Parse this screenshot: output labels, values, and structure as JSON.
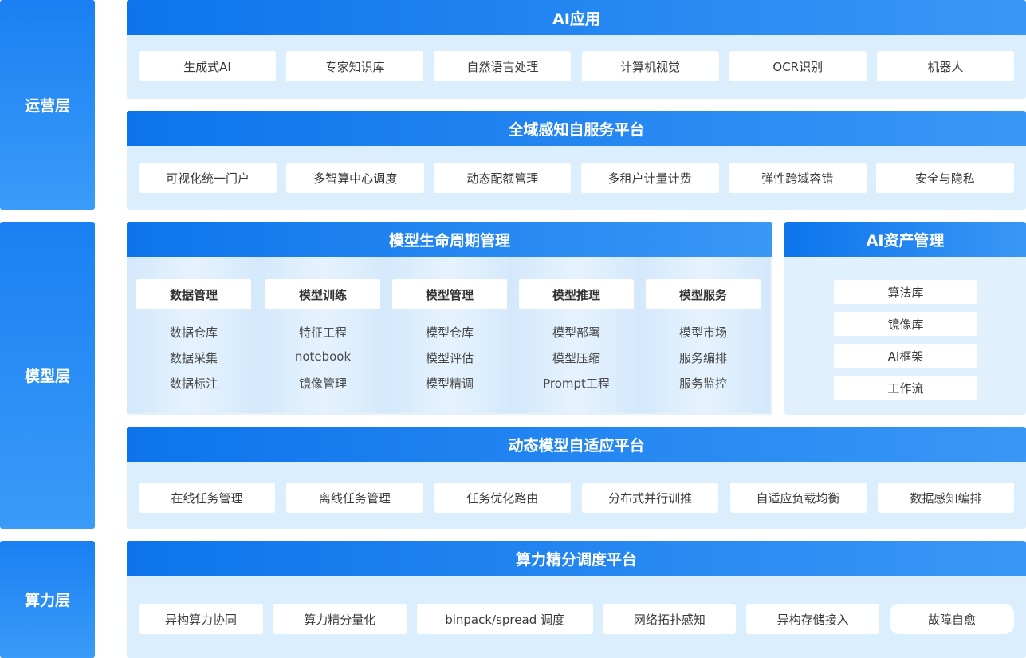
{
  "layers": {
    "ops": "运营层",
    "model": "模型层",
    "compute": "算力层"
  },
  "ai_app": {
    "title": "AI应用",
    "items": [
      "生成式AI",
      "专家知识库",
      "自然语言处理",
      "计算机视觉",
      "OCR识别",
      "机器人"
    ]
  },
  "self_service": {
    "title": "全域感知自服务平台",
    "items": [
      "可视化统一门户",
      "多智算中心调度",
      "动态配额管理",
      "多租户计量计费",
      "弹性跨域容错",
      "安全与隐私"
    ]
  },
  "lifecycle": {
    "title": "模型生命周期管理",
    "columns": [
      {
        "title": "数据管理",
        "items": [
          "数据仓库",
          "数据采集",
          "数据标注"
        ]
      },
      {
        "title": "模型训练",
        "items": [
          "特征工程",
          "notebook",
          "镜像管理"
        ]
      },
      {
        "title": "模型管理",
        "items": [
          "模型仓库",
          "模型评估",
          "模型精调"
        ]
      },
      {
        "title": "模型推理",
        "items": [
          "模型部署",
          "模型压缩",
          "Prompt工程"
        ]
      },
      {
        "title": "模型服务",
        "items": [
          "模型市场",
          "服务编排",
          "服务监控"
        ]
      }
    ]
  },
  "assets": {
    "title": "AI资产管理",
    "items": [
      "算法库",
      "镜像库",
      "AI框架",
      "工作流"
    ]
  },
  "adaptive": {
    "title": "动态模型自适应平台",
    "items": [
      "在线任务管理",
      "离线任务管理",
      "任务优化路由",
      "分布式并行训推",
      "自适应负载均衡",
      "数据感知编排"
    ]
  },
  "scheduling": {
    "title": "算力精分调度平台",
    "items": [
      "异构算力协同",
      "算力精分量化",
      "binpack/spread 调度",
      "网络拓扑感知",
      "异构存储接入",
      "故障自愈"
    ]
  }
}
